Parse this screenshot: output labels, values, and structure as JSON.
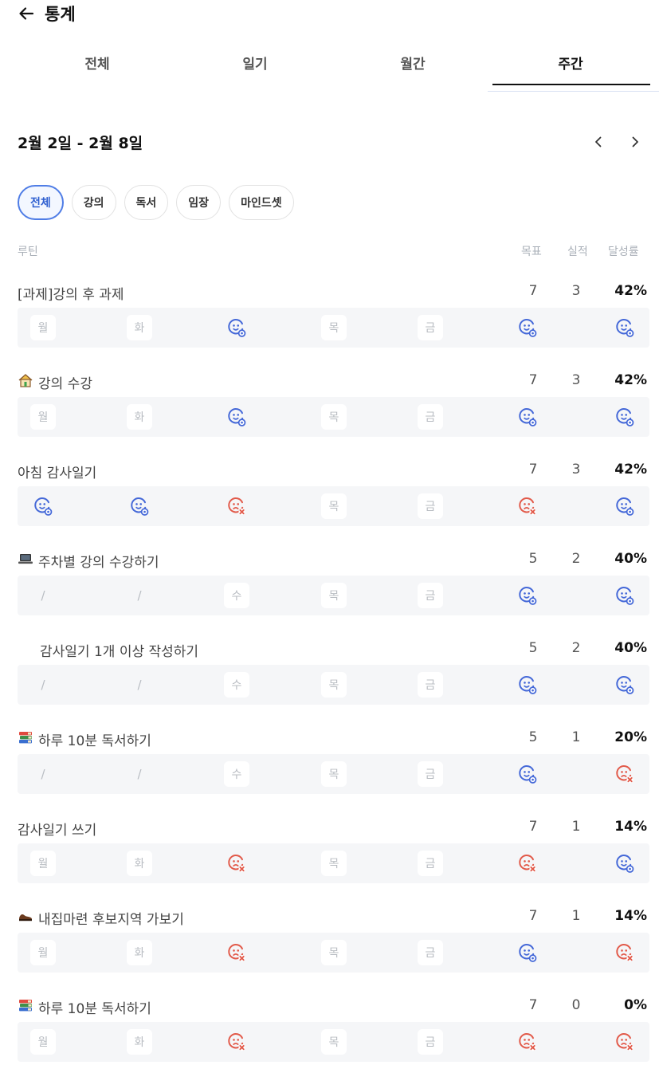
{
  "header": {
    "title": "통계",
    "back_icon": "arrow-left-icon"
  },
  "tabs": [
    {
      "label": "전체",
      "active": false
    },
    {
      "label": "일기",
      "active": false
    },
    {
      "label": "월간",
      "active": false
    },
    {
      "label": "주간",
      "active": true
    }
  ],
  "week": {
    "label": "2월 2일 - 2월 8일"
  },
  "chips": [
    {
      "label": "전체",
      "active": true
    },
    {
      "label": "강의",
      "active": false
    },
    {
      "label": "독서",
      "active": false
    },
    {
      "label": "임장",
      "active": false
    },
    {
      "label": "마인드셋",
      "active": false
    }
  ],
  "columns": {
    "routine": "루틴",
    "goal": "목표",
    "actual": "실적",
    "rate": "달성률"
  },
  "colors": {
    "accent": "#4f7de6",
    "success": "#4468d8",
    "fail": "#e25a4a",
    "muted": "#b8bcc2"
  },
  "routines": [
    {
      "name": "[과제]강의 후 과제",
      "goal": "7",
      "actual": "3",
      "rate": "42%",
      "days": [
        {
          "t": "txt",
          "v": "월"
        },
        {
          "t": "txt",
          "v": "화"
        },
        {
          "t": "ok"
        },
        {
          "t": "txt",
          "v": "목"
        },
        {
          "t": "txt",
          "v": "금"
        },
        {
          "t": "ok"
        },
        {
          "t": "ok"
        }
      ]
    },
    {
      "name": "강의 수강",
      "emoji": "house-icon",
      "goal": "7",
      "actual": "3",
      "rate": "42%",
      "days": [
        {
          "t": "txt",
          "v": "월"
        },
        {
          "t": "txt",
          "v": "화"
        },
        {
          "t": "ok"
        },
        {
          "t": "txt",
          "v": "목"
        },
        {
          "t": "txt",
          "v": "금"
        },
        {
          "t": "ok"
        },
        {
          "t": "ok"
        }
      ]
    },
    {
      "name": "아침 감사일기",
      "goal": "7",
      "actual": "3",
      "rate": "42%",
      "days": [
        {
          "t": "ok"
        },
        {
          "t": "ok"
        },
        {
          "t": "fail"
        },
        {
          "t": "txt",
          "v": "목"
        },
        {
          "t": "txt",
          "v": "금"
        },
        {
          "t": "fail"
        },
        {
          "t": "ok"
        }
      ]
    },
    {
      "name": "주차별 강의 수강하기",
      "emoji": "laptop-icon",
      "goal": "5",
      "actual": "2",
      "rate": "40%",
      "days": [
        {
          "t": "slash",
          "v": "/"
        },
        {
          "t": "slash",
          "v": "/"
        },
        {
          "t": "txt",
          "v": "수"
        },
        {
          "t": "txt",
          "v": "목"
        },
        {
          "t": "txt",
          "v": "금"
        },
        {
          "t": "ok"
        },
        {
          "t": "ok"
        }
      ]
    },
    {
      "name": "감사일기 1개 이상 작성하기",
      "indented": true,
      "goal": "5",
      "actual": "2",
      "rate": "40%",
      "days": [
        {
          "t": "slash",
          "v": "/"
        },
        {
          "t": "slash",
          "v": "/"
        },
        {
          "t": "txt",
          "v": "수"
        },
        {
          "t": "txt",
          "v": "목"
        },
        {
          "t": "txt",
          "v": "금"
        },
        {
          "t": "ok"
        },
        {
          "t": "ok"
        }
      ]
    },
    {
      "name": "하루 10분 독서하기",
      "emoji": "books-icon",
      "goal": "5",
      "actual": "1",
      "rate": "20%",
      "days": [
        {
          "t": "slash",
          "v": "/"
        },
        {
          "t": "slash",
          "v": "/"
        },
        {
          "t": "txt",
          "v": "수"
        },
        {
          "t": "txt",
          "v": "목"
        },
        {
          "t": "txt",
          "v": "금"
        },
        {
          "t": "ok"
        },
        {
          "t": "fail"
        }
      ]
    },
    {
      "name": "감사일기 쓰기",
      "goal": "7",
      "actual": "1",
      "rate": "14%",
      "days": [
        {
          "t": "txt",
          "v": "월"
        },
        {
          "t": "txt",
          "v": "화"
        },
        {
          "t": "fail"
        },
        {
          "t": "txt",
          "v": "목"
        },
        {
          "t": "txt",
          "v": "금"
        },
        {
          "t": "fail"
        },
        {
          "t": "ok"
        }
      ]
    },
    {
      "name": "내집마련 후보지역 가보기",
      "emoji": "shoe-icon",
      "goal": "7",
      "actual": "1",
      "rate": "14%",
      "days": [
        {
          "t": "txt",
          "v": "월"
        },
        {
          "t": "txt",
          "v": "화"
        },
        {
          "t": "fail"
        },
        {
          "t": "txt",
          "v": "목"
        },
        {
          "t": "txt",
          "v": "금"
        },
        {
          "t": "ok"
        },
        {
          "t": "fail"
        }
      ]
    },
    {
      "name": "하루 10분 독서하기",
      "emoji": "books-icon",
      "goal": "7",
      "actual": "0",
      "rate": "0%",
      "days": [
        {
          "t": "txt",
          "v": "월"
        },
        {
          "t": "txt",
          "v": "화"
        },
        {
          "t": "fail"
        },
        {
          "t": "txt",
          "v": "목"
        },
        {
          "t": "txt",
          "v": "금"
        },
        {
          "t": "fail"
        },
        {
          "t": "fail"
        }
      ]
    }
  ]
}
